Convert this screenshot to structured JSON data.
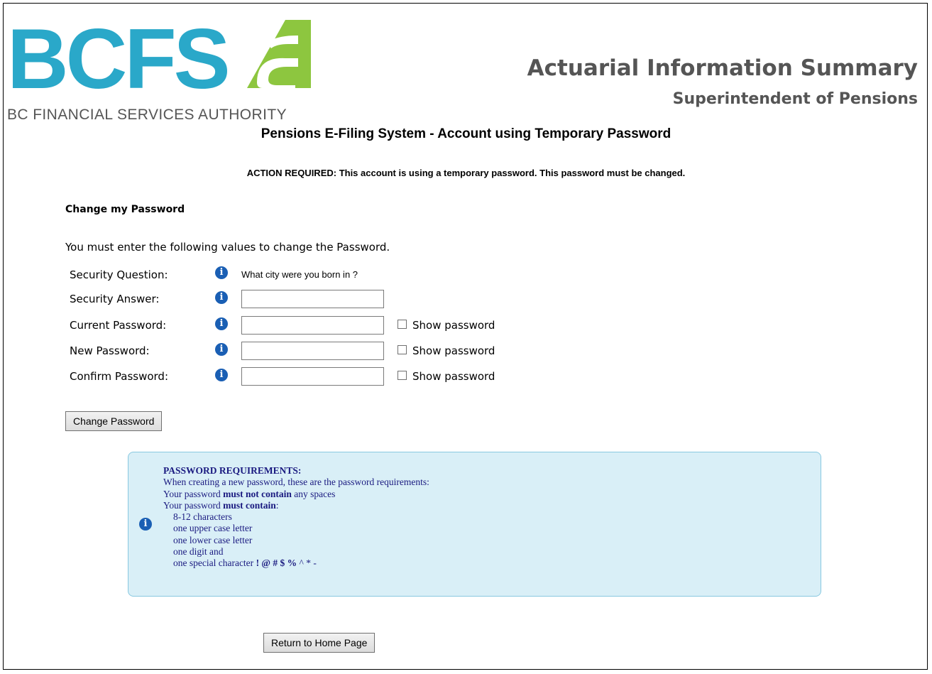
{
  "brand": {
    "logo_text": "BCFSA",
    "logo_subtitle": "BC FINANCIAL SERVICES AUTHORITY",
    "colors": {
      "teal": "#2aa8c9",
      "green": "#8dc63f",
      "grey": "#555555"
    }
  },
  "header": {
    "title": "Actuarial Information Summary",
    "subtitle": "Superintendent of Pensions"
  },
  "page": {
    "system_title": "Pensions E-Filing System - Account using Temporary Password",
    "action_required": "ACTION REQUIRED: This account is using a temporary password. This password must be changed.",
    "section_title": "Change my Password",
    "intro": "You must enter the following values to change the Password."
  },
  "form": {
    "security_question_label": "Security Question:",
    "security_question_value": "What city were you born in ?",
    "security_answer_label": "Security Answer:",
    "current_password_label": "Current Password:",
    "new_password_label": "New Password:",
    "confirm_password_label": "Confirm Password:",
    "show_password_label": "Show password",
    "info_icon_glyph": "i",
    "change_button": "Change Password"
  },
  "requirements": {
    "heading": "PASSWORD REQUIREMENTS:",
    "intro": "When creating a new password, these are the password requirements:",
    "no_spaces_prefix": "Your password ",
    "no_spaces_bold": "must not contain",
    "no_spaces_suffix": " any spaces",
    "must_contain_prefix": "Your password ",
    "must_contain_bold": "must contain",
    "must_contain_suffix": ":",
    "items": [
      "8-12 characters",
      "one upper case letter",
      "one lower case letter",
      "one digit and"
    ],
    "special_prefix": "one special character ",
    "special_chars": "! @ # $ %",
    "special_rest": " ^ * -"
  },
  "footer": {
    "return_button": "Return to Home Page"
  }
}
